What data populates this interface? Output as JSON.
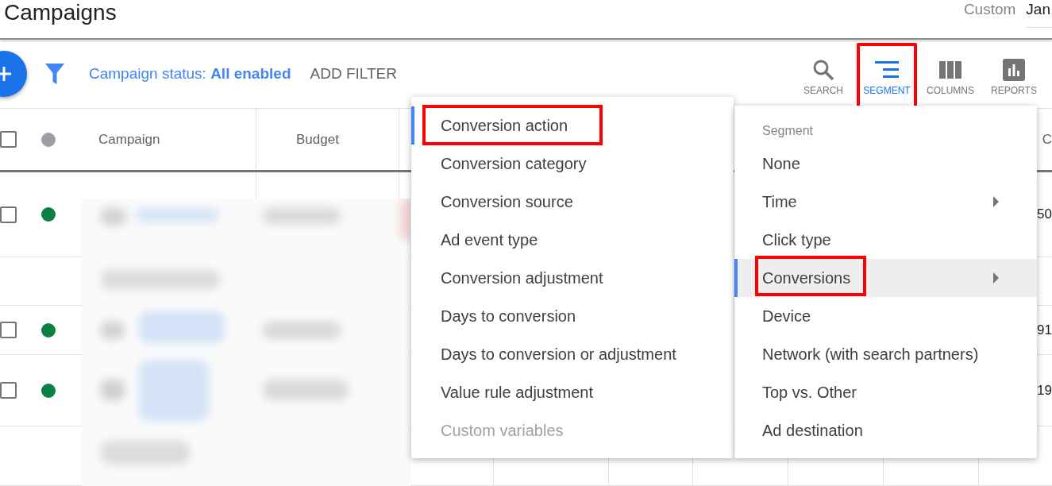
{
  "header": {
    "title": "Campaigns",
    "date_range": {
      "label": "Custom",
      "value": "Jan"
    }
  },
  "toolbar": {
    "filter_label": "Campaign status: **All enabled**",
    "add_filter": "ADD FILTER",
    "tools": [
      {
        "kind": "search",
        "label": "SEARCH",
        "selected": false,
        "highlighted": false
      },
      {
        "kind": "segment",
        "label": "SEGMENT",
        "selected": true,
        "highlighted": true
      },
      {
        "kind": "columns",
        "label": "COLUMNS",
        "selected": false,
        "highlighted": false
      },
      {
        "kind": "reports",
        "label": "REPORTS",
        "selected": false,
        "highlighted": false
      }
    ]
  },
  "table": {
    "header_checkbox": {
      "checked": false
    },
    "columns": [
      {
        "label": "Campaign"
      },
      {
        "label": "Budget"
      },
      {},
      {},
      {},
      {},
      {},
      {},
      {
        "label": "C"
      }
    ],
    "rows": [
      {
        "kind": "campaign",
        "checked": false,
        "color": "#0b8043",
        "value": "50"
      },
      {
        "kind": "detail"
      },
      {
        "kind": "campaign",
        "checked": false,
        "color": "#0b8043",
        "value": "91"
      },
      {
        "kind": "campaign",
        "checked": false,
        "color": "#0b8043",
        "value": "19"
      },
      {
        "kind": "detail"
      }
    ]
  },
  "conversions_submenu": {
    "items": [
      {
        "label": "Conversion action",
        "selected": true,
        "disabled": false,
        "highlighted": true
      },
      {
        "label": "Conversion category",
        "selected": false,
        "disabled": false,
        "highlighted": false
      },
      {
        "label": "Conversion source",
        "selected": false,
        "disabled": false,
        "highlighted": false
      },
      {
        "label": "Ad event type",
        "selected": false,
        "disabled": false,
        "highlighted": false
      },
      {
        "label": "Conversion adjustment",
        "selected": false,
        "disabled": false,
        "highlighted": false
      },
      {
        "label": "Days to conversion",
        "selected": false,
        "disabled": false,
        "highlighted": false
      },
      {
        "label": "Days to conversion or adjustment",
        "selected": false,
        "disabled": false,
        "highlighted": false
      },
      {
        "label": "Value rule adjustment",
        "selected": false,
        "disabled": false,
        "highlighted": false
      },
      {
        "label": "Custom variables",
        "selected": false,
        "disabled": true,
        "highlighted": false
      }
    ]
  },
  "segment_menu": {
    "title": "Segment",
    "items": [
      {
        "label": "None",
        "has_submenu": false,
        "selected": false,
        "highlighted": false
      },
      {
        "label": "Time",
        "has_submenu": true,
        "selected": false,
        "highlighted": false
      },
      {
        "label": "Click type",
        "has_submenu": false,
        "selected": false,
        "highlighted": false
      },
      {
        "label": "Conversions",
        "has_submenu": true,
        "selected": true,
        "highlighted": true
      },
      {
        "label": "Device",
        "has_submenu": false,
        "selected": false,
        "highlighted": false
      },
      {
        "label": "Network (with search partners)",
        "has_submenu": false,
        "selected": false,
        "highlighted": false
      },
      {
        "label": "Top vs. Other",
        "has_submenu": false,
        "selected": false,
        "highlighted": false
      },
      {
        "label": "Ad destination",
        "has_submenu": false,
        "selected": false,
        "highlighted": false
      }
    ]
  }
}
